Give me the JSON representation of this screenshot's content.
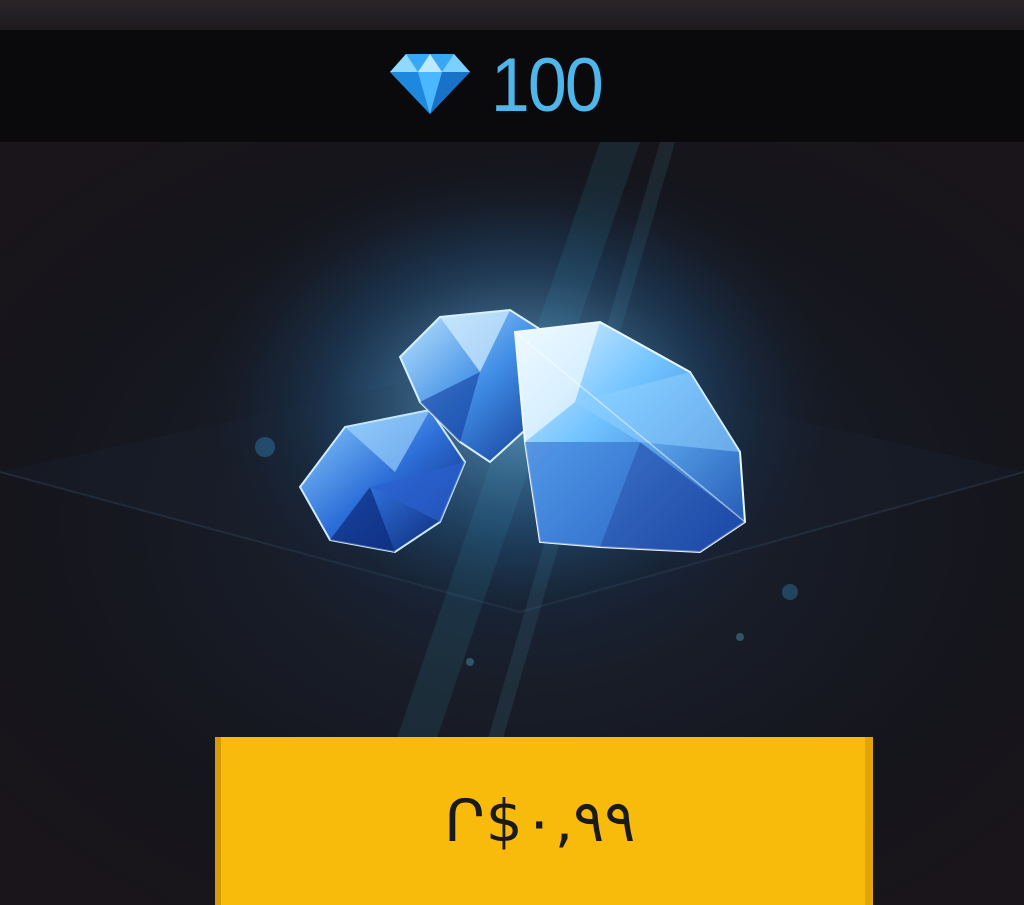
{
  "pack": {
    "currency_icon": "diamond-icon",
    "amount": "100",
    "price": "Ր$٠,٩٩",
    "accent_color": "#4fb6ec",
    "price_tag_color": "#f8bb0c"
  }
}
